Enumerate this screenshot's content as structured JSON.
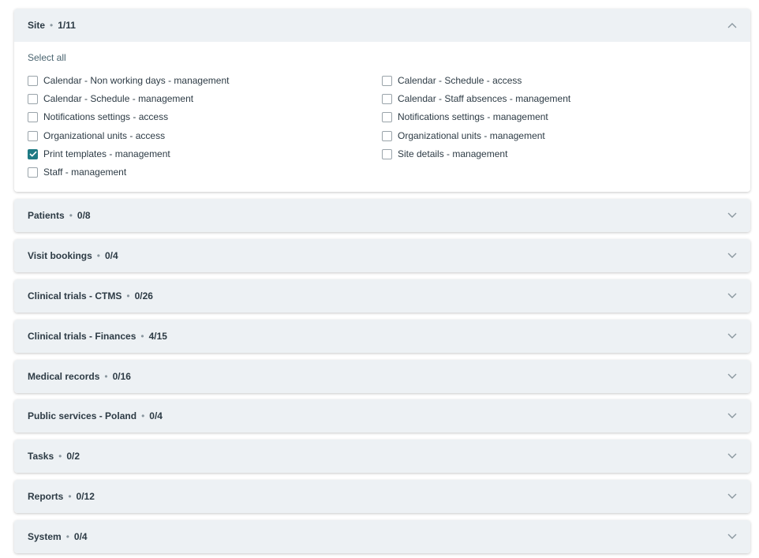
{
  "colors": {
    "header_bg": "#edf1f4",
    "checked": "#1e7a84",
    "text": "#2d3b45"
  },
  "separator": "•",
  "site": {
    "title": "Site",
    "count": "1/11",
    "expanded": true,
    "select_all": "Select all",
    "options": [
      {
        "label": "Calendar - Non working days - management",
        "checked": false
      },
      {
        "label": "Calendar - Schedule - access",
        "checked": false
      },
      {
        "label": "Calendar - Schedule - management",
        "checked": false
      },
      {
        "label": "Calendar - Staff absences - management",
        "checked": false
      },
      {
        "label": "Notifications settings - access",
        "checked": false
      },
      {
        "label": "Notifications settings - management",
        "checked": false
      },
      {
        "label": "Organizational units - access",
        "checked": false
      },
      {
        "label": "Organizational units - management",
        "checked": false
      },
      {
        "label": "Print templates - management",
        "checked": true
      },
      {
        "label": "Site details - management",
        "checked": false
      },
      {
        "label": "Staff - management",
        "checked": false
      }
    ]
  },
  "sections": [
    {
      "title": "Patients",
      "count": "0/8"
    },
    {
      "title": "Visit bookings",
      "count": "0/4"
    },
    {
      "title": "Clinical trials - CTMS",
      "count": "0/26"
    },
    {
      "title": "Clinical trials - Finances",
      "count": "4/15"
    },
    {
      "title": "Medical records",
      "count": "0/16"
    },
    {
      "title": "Public services - Poland",
      "count": "0/4"
    },
    {
      "title": "Tasks",
      "count": "0/2"
    },
    {
      "title": "Reports",
      "count": "0/12"
    },
    {
      "title": "System",
      "count": "0/4"
    }
  ]
}
